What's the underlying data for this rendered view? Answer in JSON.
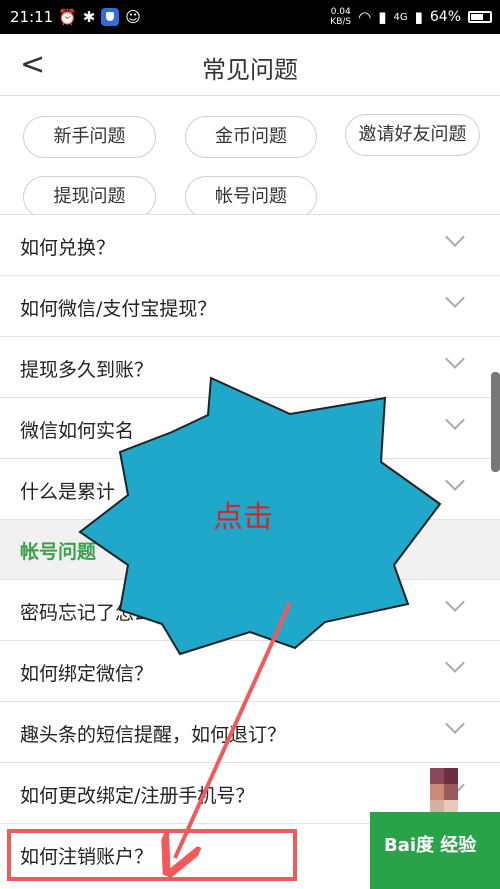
{
  "status_bar": {
    "time": "21:11",
    "speed_value": "0.04",
    "speed_unit": "KB/S",
    "network": "4G",
    "battery": "64%"
  },
  "header": {
    "title": "常见问题",
    "back_icon": "chevron-left-icon"
  },
  "tags": [
    {
      "label": "新手问题"
    },
    {
      "label": "金币问题"
    },
    {
      "label": "邀请好友问题"
    },
    {
      "label": "提现问题"
    },
    {
      "label": "帐号问题"
    }
  ],
  "list": {
    "rows_top": [
      {
        "label": "如何兑换？"
      },
      {
        "label": "如何微信/支付宝提现？"
      },
      {
        "label": "提现多久到账？"
      },
      {
        "label": "微信如何实名"
      },
      {
        "label": "什么是累计"
      }
    ],
    "section_title": "帐号问题",
    "rows_bottom": [
      {
        "label": "密码忘记了怎么办？"
      },
      {
        "label": "如何绑定微信？"
      },
      {
        "label": "趣头条的短信提醒，如何退订？"
      },
      {
        "label": "如何更改绑定/注册手机号？"
      },
      {
        "label": "如何注销账户？"
      }
    ]
  },
  "annotation": {
    "callout_text": "点击",
    "callout_color": "#1fa8c9",
    "arrow_color": "#f05a5a"
  },
  "watermark": {
    "text": "Bai度 经验"
  }
}
